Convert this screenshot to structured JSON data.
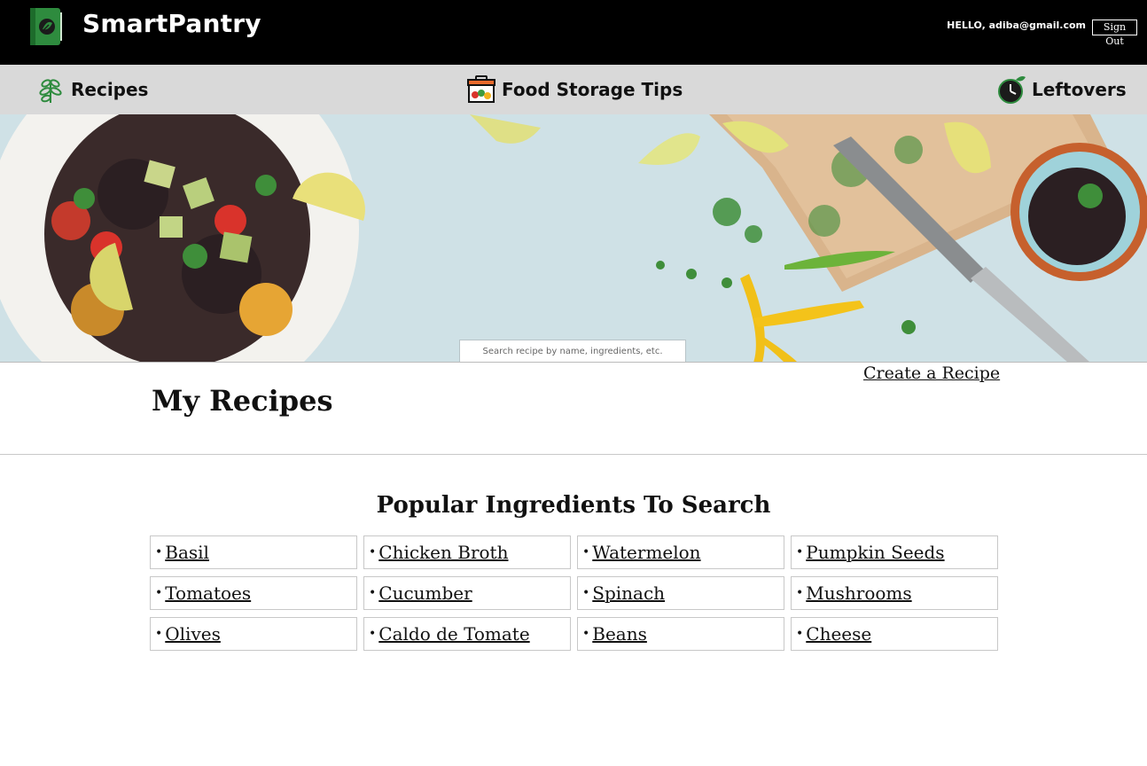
{
  "header": {
    "brand": "SmartPantry",
    "greeting": "HELLO, adiba@gmail.com",
    "sign_out": "Sign Out",
    "logo_icon": "book-leaf-icon"
  },
  "nav": [
    {
      "label": "Recipes",
      "icon": "herb-icon"
    },
    {
      "label": "Food Storage Tips",
      "icon": "pantry-box-icon"
    },
    {
      "label": "Leftovers",
      "icon": "clock-leaf-icon"
    }
  ],
  "hero": {
    "search_placeholder": "Search recipe by name, ingredients, etc."
  },
  "my_recipes": {
    "title": "My Recipes",
    "create_link": "Create a Recipe"
  },
  "popular": {
    "title": "Popular Ingredients To Search",
    "bullet": "•",
    "items": [
      "Basil",
      "Chicken Broth",
      "Watermelon",
      "Pumpkin Seeds",
      "Tomatoes",
      "Cucumber",
      "Spinach",
      "Mushrooms",
      "Olives",
      "Caldo de Tomate",
      "Beans",
      "Cheese"
    ]
  },
  "colors": {
    "header_bg": "#000000",
    "nav_bg": "#d9d9d9",
    "brand_green": "#2e8b3e",
    "hero_bg": "#cfe1e6"
  }
}
